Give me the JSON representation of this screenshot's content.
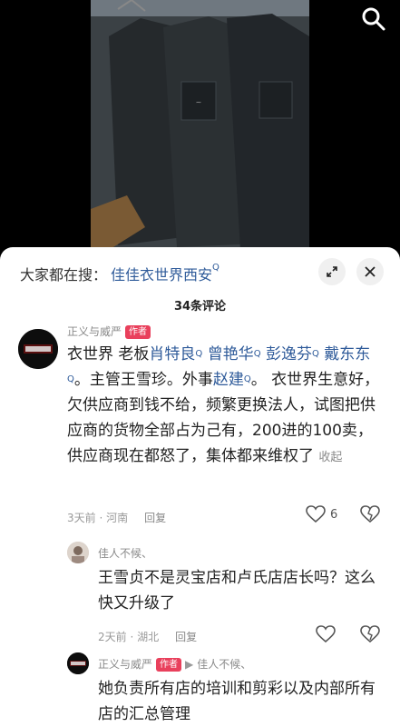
{
  "search_hint": {
    "label": "大家都在搜：",
    "query": "佳佳衣世界西安"
  },
  "comments_header": {
    "count_label": "34条评论"
  },
  "comments": [
    {
      "author": "正义与威严",
      "author_tag": "作者",
      "parts": {
        "p1": "衣世界  老板",
        "m1": "肖特良",
        "p2": " ",
        "m2": "曾艳华",
        "p3": " ",
        "m3": "彭逸芬",
        "p4": " ",
        "m4": "戴东东",
        "p5": "。主管王雪珍。外事",
        "m5": "赵建",
        "p6": "。  衣世界生意好，欠供应商到钱不给，频繁更换法人，试图把供应商的货物全部占为己有，200进的100卖，供应商现在都怒了，集体都来维权了",
        "collapse": "收起"
      },
      "meta": {
        "time": "3天前",
        "location": "河南",
        "reply": "回复"
      },
      "likes": "6"
    },
    {
      "author": "佳人不候、",
      "text": "王雪贞不是灵宝店和卢氏店店长吗？这么快又升级了",
      "meta": {
        "time": "2天前",
        "location": "湖北",
        "reply": "回复"
      }
    },
    {
      "author": "正义与威严",
      "author_tag": "作者",
      "reply_to": "佳人不候、",
      "text": "她负责所有店的培训和剪彩以及内部所有店的汇总管理"
    }
  ],
  "colors": {
    "link": "#2f5b9a",
    "author_tag": "#e9405c",
    "muted": "#999999"
  },
  "icons": [
    "search-icon",
    "collapse-icon",
    "close-icon",
    "heart-icon",
    "broken-heart-icon",
    "search-link-icon"
  ]
}
